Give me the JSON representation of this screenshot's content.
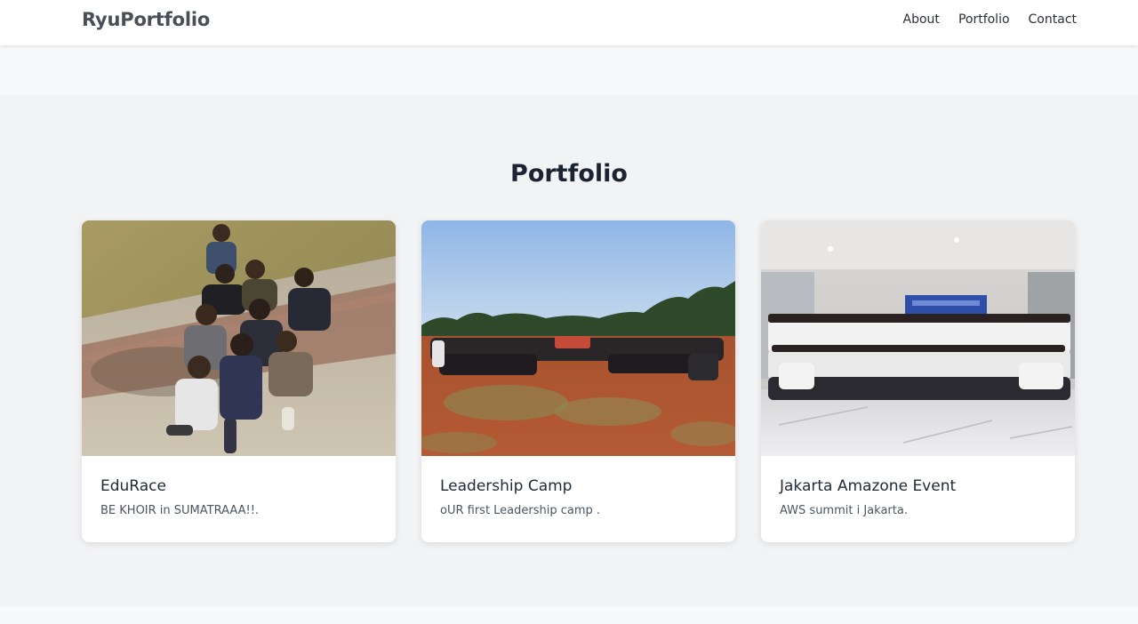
{
  "navbar": {
    "brand": "RyuPortfolio",
    "links": [
      "About",
      "Portfolio",
      "Contact"
    ]
  },
  "portfolio": {
    "title": "Portfolio",
    "cards": [
      {
        "title": "EduRace",
        "description": "BE KHOIR in SUMATRAAA!!."
      },
      {
        "title": "Leadership Camp",
        "description": "oUR first Leadership camp ."
      },
      {
        "title": "Jakarta Amazone Event",
        "description": "AWS summit i Jakarta."
      }
    ]
  },
  "colors": {
    "navbar_bg": "#ffffff",
    "page_bg": "#f8f9fb",
    "section_bg": "#f2f3f5",
    "brand_text": "#4a4f57",
    "title_text": "#1c2433"
  }
}
